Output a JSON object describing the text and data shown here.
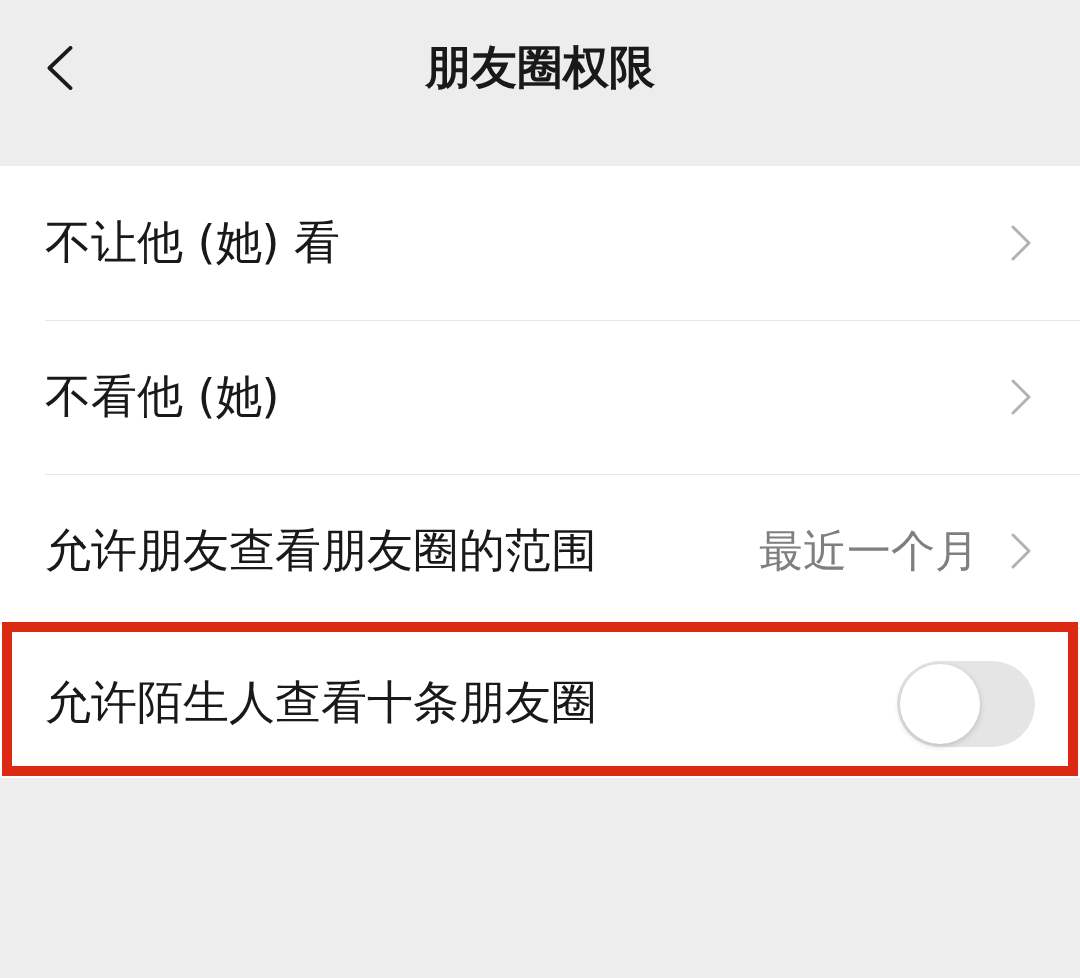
{
  "header": {
    "title": "朋友圈权限"
  },
  "settings": [
    {
      "kind": "link",
      "label": "不让他 (她) 看",
      "highlighted": false
    },
    {
      "kind": "link",
      "label": "不看他 (她)",
      "highlighted": false
    },
    {
      "kind": "link",
      "label": "允许朋友查看朋友圈的范围",
      "value": "最近一个月",
      "highlighted": false
    },
    {
      "kind": "toggle",
      "label": "允许陌生人查看十条朋友圈",
      "on": false,
      "highlighted": true
    }
  ]
}
